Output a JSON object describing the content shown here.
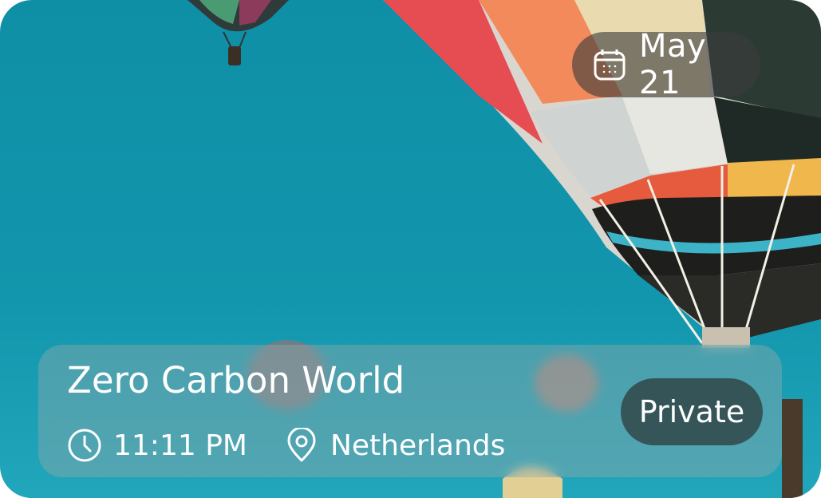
{
  "event": {
    "date": "May 21",
    "title": "Zero Carbon World",
    "time": "11:11 PM",
    "location": "Netherlands",
    "privacy": "Private"
  },
  "icons": {
    "date": "calendar-icon",
    "time": "clock-icon",
    "location": "map-pin-icon"
  },
  "colors": {
    "sky": "#1296ad"
  }
}
